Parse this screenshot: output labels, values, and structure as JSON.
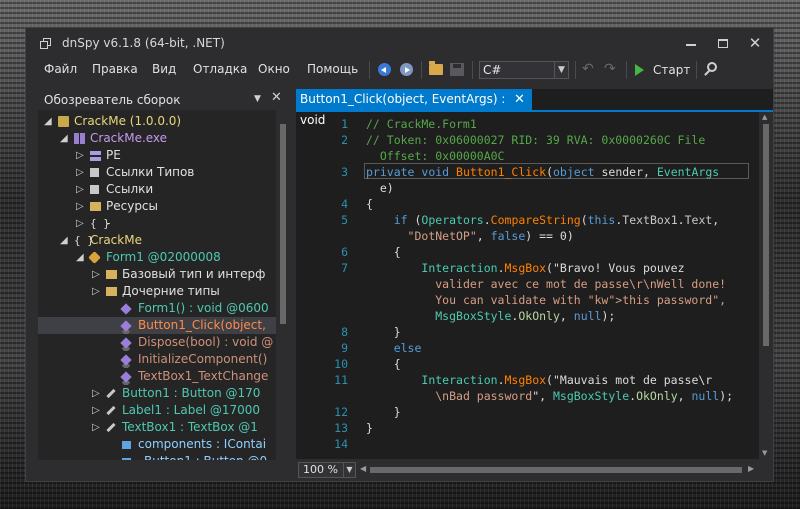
{
  "window": {
    "title": "dnSpy v6.1.8 (64-bit, .NET)",
    "controls": {
      "minimize": "",
      "maximize": "",
      "close": "✕"
    }
  },
  "menu": [
    "Файл",
    "Правка",
    "Вид",
    "Отладка",
    "Окно",
    "Помощь"
  ],
  "toolbar": {
    "language": "C#",
    "run_label": "Старт",
    "icons": [
      "back-icon",
      "forward-icon",
      "open-icon",
      "save-icon",
      "undo-icon",
      "redo-icon",
      "run-icon",
      "find-icon"
    ]
  },
  "assembly_explorer": {
    "title": "Обозреватель сборок",
    "menu_glyph": "▼",
    "close_glyph": "✕",
    "tree": [
      {
        "expander": "◢",
        "icon": "assembly",
        "label": "CrackMe (1.0.0.0)",
        "style": "asm"
      },
      {
        "expander": "◢",
        "icon": "module",
        "label": "CrackMe.exe",
        "style": "mod"
      },
      {
        "expander": "▷",
        "icon": "pe",
        "label": "PE",
        "style": ""
      },
      {
        "expander": "▷",
        "icon": "ref",
        "label": "Ссылки Типов",
        "style": ""
      },
      {
        "expander": "▷",
        "icon": "ref",
        "label": "Ссылки",
        "style": ""
      },
      {
        "expander": "▷",
        "icon": "folder",
        "label": "Ресурсы",
        "style": ""
      },
      {
        "expander": "▷",
        "icon": "ns",
        "label": "-",
        "style": ""
      },
      {
        "expander": "◢",
        "icon": "ns",
        "label": "CrackMe",
        "style": "ns"
      },
      {
        "expander": "◢",
        "icon": "class",
        "label": "Form1 @02000008",
        "style": "type"
      },
      {
        "expander": "▷",
        "icon": "folder",
        "label": "Базовый тип и интерф",
        "style": ""
      },
      {
        "expander": "▷",
        "icon": "folder",
        "label": "Дочерние типы",
        "style": ""
      },
      {
        "expander": "",
        "icon": "method",
        "label": "Form1() : void @0600",
        "style": "type"
      },
      {
        "expander": "",
        "icon": "method-lock",
        "label": "Button1_Click(object,",
        "style": "private"
      },
      {
        "expander": "",
        "icon": "method-lock",
        "label": "Dispose(bool) : void @",
        "style": "method"
      },
      {
        "expander": "",
        "icon": "method-lock",
        "label": "InitializeComponent()",
        "style": "method"
      },
      {
        "expander": "",
        "icon": "method-lock",
        "label": "TextBox1_TextChange",
        "style": "method"
      },
      {
        "expander": "▷",
        "icon": "wrench",
        "label": "Button1 : Button @170",
        "style": "type"
      },
      {
        "expander": "▷",
        "icon": "wrench",
        "label": "Label1 : Label @17000",
        "style": "type"
      },
      {
        "expander": "▷",
        "icon": "wrench",
        "label": "TextBox1 : TextBox @1",
        "style": "type"
      },
      {
        "expander": "",
        "icon": "field",
        "label": "components : IContai",
        "style": "field"
      },
      {
        "expander": "",
        "icon": "field",
        "label": "_Button1 : Button @0",
        "style": "field"
      }
    ]
  },
  "editor": {
    "tab_title": "Button1_Click(object, EventArgs) : void",
    "tab_close": "✕",
    "zoom": "100 %",
    "line_numbers": [
      "1",
      "2",
      "",
      "3",
      "",
      "4",
      "5",
      "",
      "6",
      "7",
      "",
      "",
      "",
      "8",
      "9",
      "10",
      "11",
      "",
      "12",
      "13",
      "14"
    ],
    "code_lines": [
      "// CrackMe.Form1",
      "// Token: 0x06000027 RID: 39 RVA: 0x0000260C File",
      "  Offset: 0x00000A0C",
      "private void Button1_Click(object sender, EventArgs",
      "  e)",
      "{",
      "    if (Operators.CompareString(this.TextBox1.Text,",
      "      \"DotNetOP\", false) == 0)",
      "    {",
      "        Interaction.MsgBox(\"Bravo! Vous pouvez",
      "          valider avec ce mot de passe\\r\\nWell done!",
      "          You can validate with this password\",",
      "          MsgBoxStyle.OkOnly, null);",
      "    }",
      "    else",
      "    {",
      "        Interaction.MsgBox(\"Mauvais mot de passe\\r",
      "          \\nBad password\", MsgBoxStyle.OkOnly, null);",
      "    }",
      "}",
      ""
    ]
  }
}
